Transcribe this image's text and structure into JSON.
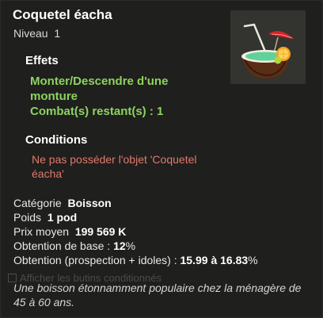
{
  "item": {
    "name": "Coquetel éacha",
    "level_label": "Niveau",
    "level_value": "1",
    "icon": "coconut-cocktail-icon"
  },
  "effects": {
    "title": "Effets",
    "lines": [
      "Monter/Descendre d'une",
      "monture",
      "Combat(s) restant(s) : 1"
    ]
  },
  "conditions": {
    "title": "Conditions",
    "lines": [
      "Ne pas posséder l'objet 'Coquetel",
      "éacha'"
    ]
  },
  "stats": {
    "category_label": "Catégorie",
    "category_value": "Boisson",
    "weight_label": "Poids",
    "weight_value": "1 pod",
    "price_label": "Prix moyen",
    "price_value": "199 569 K",
    "base_label": "Obtention de base :",
    "base_value": "12",
    "base_unit": "%",
    "prospect_label": "Obtention (prospection + idoles) :",
    "prospect_value": "15.99 à 16.83",
    "prospect_unit": "%"
  },
  "background_option": "Afficher les butins conditionnés",
  "description": "Une boisson étonnamment populaire chez la ménagère de 45 à 60 ans.",
  "colors": {
    "effect_green": "#8dd35f",
    "condition_red": "#e07a6a",
    "panel_bg": "#1f1f1e"
  }
}
